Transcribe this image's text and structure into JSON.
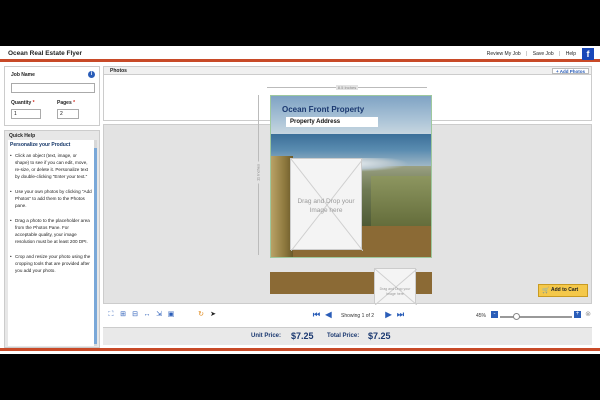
{
  "header": {
    "title": "Ocean Real Estate Flyer",
    "links": [
      "Review My Job",
      "Save Job",
      "Help"
    ],
    "social_icon": "f"
  },
  "job": {
    "job_name_label": "Job Name",
    "job_name_value": "",
    "quantity_label": "Quantity",
    "quantity_value": "1",
    "pages_label": "Pages",
    "pages_value": "2",
    "info_icon": "i"
  },
  "help": {
    "title": "Quick Help",
    "heading": "Personalize your Product",
    "items": [
      "Click an object (text, image, or shape) to see if you can edit, move, re-size, or delete it. Personalize text by double-clicking \"Enter your text.\"",
      "Use your own photos by clicking \"Add Photos\" to add them to the Photos pane.",
      "Drag a photo to the placeholder area from the Photos Pane. For acceptable quality, your image resolution must be at least 200 DPI.",
      "Crop and resize your photo using the cropping tools that are provided after you add your photo."
    ]
  },
  "photos": {
    "title": "Photos",
    "add_button": "+ Add Photos"
  },
  "canvas": {
    "width_label": "8.5 Inches",
    "height_label": "11 Inches",
    "flyer_title": "Ocean Front Property",
    "address": "Property Address",
    "main_placeholder": "Drag and Drop your Image here",
    "small_placeholder": "Drag and Drop your Image here"
  },
  "pager": {
    "showing": "Showing 1 of 2",
    "zoom": "45%",
    "zoom_minus": "-",
    "zoom_plus": "+"
  },
  "pricing": {
    "unit_label": "Unit Price:",
    "unit_value": "$7.25",
    "total_label": "Total Price:",
    "total_value": "$7.25",
    "cart_button": "Add to Cart"
  },
  "colors": {
    "accent": "#c84a28",
    "link": "#2a5db8",
    "price": "#1a3870",
    "cart": "#f4c84a"
  }
}
